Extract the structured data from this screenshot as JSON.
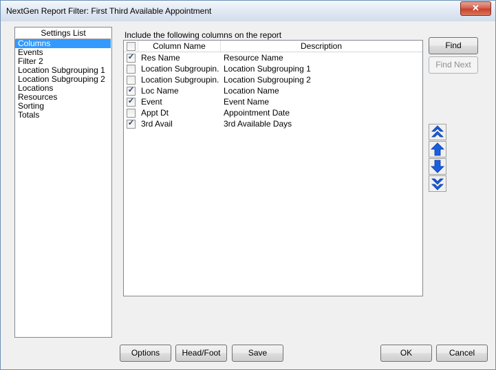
{
  "window": {
    "title": "NextGen Report Filter: First Third Available Appointment",
    "close_label": "✕"
  },
  "settings": {
    "header": "Settings List",
    "items": [
      {
        "label": "Columns",
        "selected": true
      },
      {
        "label": "Events"
      },
      {
        "label": "Filter 2"
      },
      {
        "label": "Location Subgrouping 1"
      },
      {
        "label": "Location Subgrouping 2"
      },
      {
        "label": "Locations"
      },
      {
        "label": "Resources"
      },
      {
        "label": "Sorting"
      },
      {
        "label": "Totals"
      }
    ]
  },
  "columns": {
    "instruction": "Include the following columns on the report",
    "headers": {
      "name": "Column Name",
      "description": "Description"
    },
    "rows": [
      {
        "name": "Res Name",
        "description": "Resource Name",
        "checked": true
      },
      {
        "name": "Location  Subgroupin...",
        "description": "Location Subgrouping 1",
        "checked": false
      },
      {
        "name": "Location  Subgroupin...",
        "description": "Location Subgrouping 2",
        "checked": false
      },
      {
        "name": "Loc Name",
        "description": "Location Name",
        "checked": true
      },
      {
        "name": "Event",
        "description": "Event Name",
        "checked": true
      },
      {
        "name": "Appt Dt",
        "description": "Appointment Date",
        "checked": false
      },
      {
        "name": "3rd Avail",
        "description": "3rd Available Days",
        "checked": true
      }
    ]
  },
  "buttons": {
    "find": "Find",
    "find_next": "Find Next",
    "options": "Options",
    "head_foot": "Head/Foot",
    "save": "Save",
    "ok": "OK",
    "cancel": "Cancel"
  },
  "colors": {
    "arrow_blue": "#1a5fe0",
    "selection": "#3399ff"
  }
}
